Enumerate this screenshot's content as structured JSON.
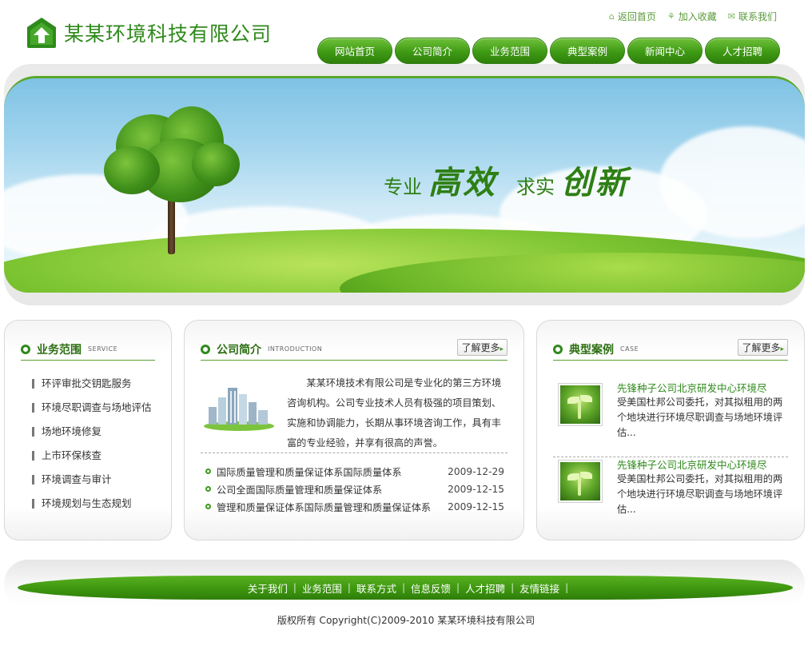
{
  "header": {
    "company_name": "某某环境科技有限公司",
    "top_links": [
      {
        "icon": "home-icon",
        "label": "返回首页"
      },
      {
        "icon": "bookmark-icon",
        "label": "加入收藏"
      },
      {
        "icon": "contact-icon",
        "label": "联系我们"
      }
    ],
    "nav": [
      "网站首页",
      "公司简介",
      "业务范围",
      "典型案例",
      "新闻中心",
      "人才招聘"
    ]
  },
  "banner": {
    "slogan": [
      {
        "small": "专业",
        "large": "高效"
      },
      {
        "small": "求实",
        "large": "创新"
      }
    ]
  },
  "service": {
    "title": "业务范围",
    "subtitle": "SERVICE",
    "items": [
      "环评审批交钥匙服务",
      "环境尽职调查与场地评估",
      "场地环境修复",
      "上市环保核查",
      "环境调查与审计",
      "环境规划与生态规划"
    ]
  },
  "intro": {
    "title": "公司简介",
    "subtitle": "INTRODUCTION",
    "more_label": "了解更多",
    "text": "某某环境技术有限公司是专业化的第三方环境咨询机构。公司专业技术人员有极强的项目策划、实施和协调能力，长期从事环境咨询工作，具有丰富的专业经验，并享有很高的声誉。",
    "news": [
      {
        "title": "国际质量管理和质量保证体系国际质量体系",
        "date": "2009-12-29"
      },
      {
        "title": "公司全面国际质量管理和质量保证体系",
        "date": "2009-12-15"
      },
      {
        "title": "管理和质量保证体系国际质量管理和质量保证体系",
        "date": "2009-12-15"
      }
    ]
  },
  "cases": {
    "title": "典型案例",
    "subtitle": "CASE",
    "more_label": "了解更多",
    "items": [
      {
        "title": "先锋种子公司北京研发中心环境尽",
        "desc": "受美国杜邦公司委托，对其拟租用的两个地块进行环境尽职调查与场地环境评估..."
      },
      {
        "title": "先锋种子公司北京研发中心环境尽",
        "desc": "受美国杜邦公司委托，对其拟租用的两个地块进行环境尽职调查与场地环境评估..."
      }
    ]
  },
  "footer": {
    "links": [
      "关于我们",
      "业务范围",
      "联系方式",
      "信息反馈",
      "人才招聘",
      "友情链接"
    ],
    "copyright": "版权所有  Copyright(C)2009-2010 某某环境科技有限公司"
  },
  "colors": {
    "brand_green": "#2f8a1c",
    "nav_green": "#3f9a14"
  }
}
